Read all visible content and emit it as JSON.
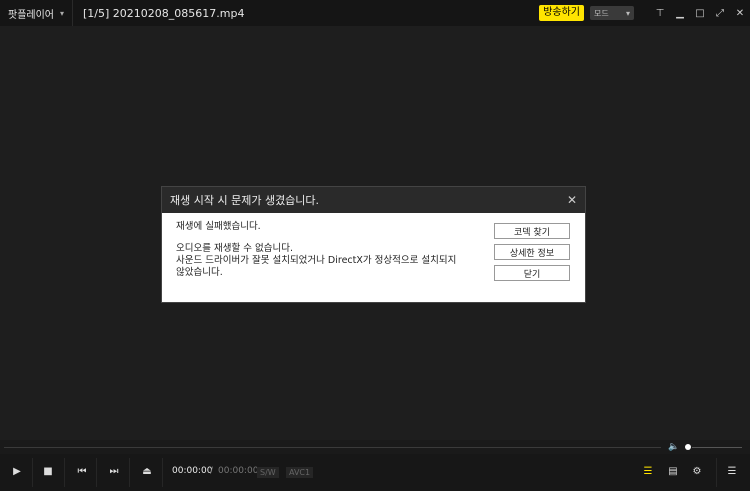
{
  "titlebar": {
    "app_name": "팟플레이어",
    "file_title": "[1/5] 20210208_085617.mp4",
    "broadcast_label": "방송하기",
    "mode_label": "모드"
  },
  "dialog": {
    "title": "재생 시작 시 문제가 생겼습니다.",
    "message_line1": "재생에 실패했습니다.",
    "message_line2": "오디오를 재생할 수 없습니다.",
    "message_line3": "사운드 드라이버가 잘못 설치되었거나 DirectX가 정상적으로 설치되지",
    "message_line4": "않았습니다.",
    "buttons": {
      "find_codec": "코덱 찾기",
      "details": "상세한 정보",
      "close": "닫기"
    }
  },
  "controls": {
    "current_time": "00:00:00",
    "time_separator": "/",
    "total_time": "00:00:00",
    "decoder_tag": "S/W",
    "codec_tag": "AVC1"
  },
  "colors": {
    "accent": "#ffe400",
    "background": "#1e1e1e",
    "titlebar": "#151515"
  }
}
